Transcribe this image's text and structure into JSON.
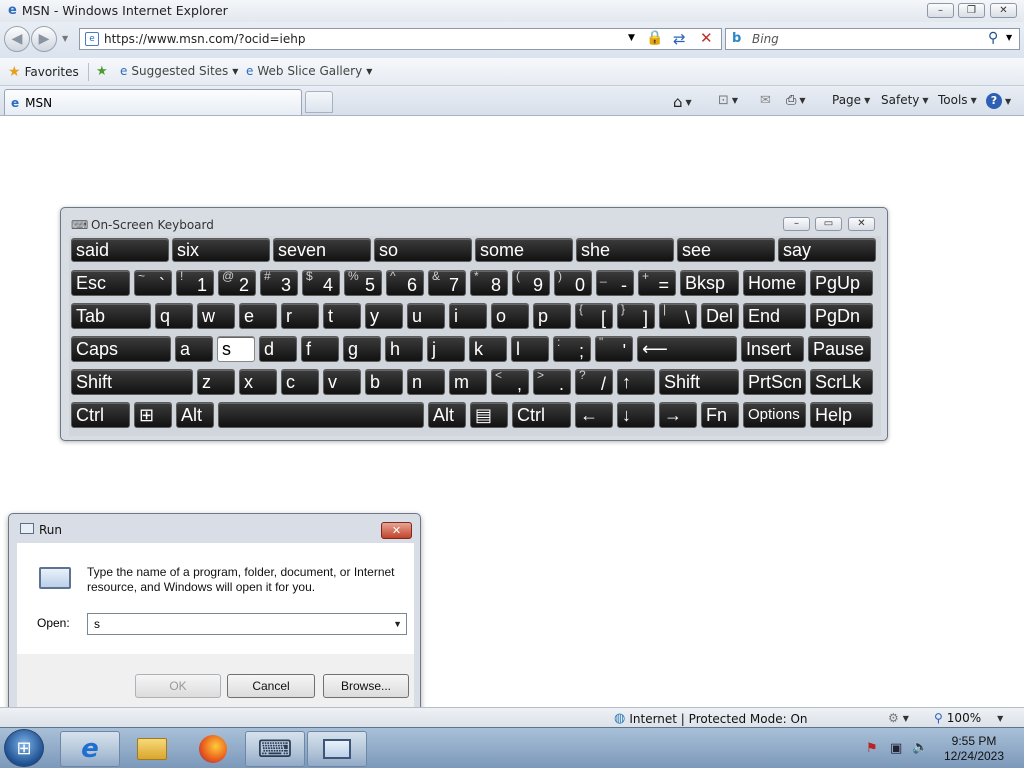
{
  "ie": {
    "window_title": "MSN - Windows Internet Explorer",
    "address": "https://www.msn.com/?ocid=iehp",
    "search_placeholder": "Bing",
    "favorites_label": "Favorites",
    "suggested_sites": "Suggested Sites",
    "web_slice_gallery": "Web Slice Gallery",
    "tab_title": "MSN",
    "cmd_page": "Page",
    "cmd_safety": "Safety",
    "cmd_tools": "Tools"
  },
  "statusbar": {
    "zone_text": "Internet | Protected Mode: On",
    "zoom": "100%"
  },
  "osk": {
    "title": "On-Screen Keyboard",
    "predictions": [
      "said",
      "six",
      "seven",
      "so",
      "some",
      "she",
      "see",
      "say"
    ],
    "rows": [
      [
        {
          "label": "Esc"
        },
        {
          "top": "~",
          "bot": "`"
        },
        {
          "top": "!",
          "bot": "1"
        },
        {
          "top": "@",
          "bot": "2"
        },
        {
          "top": "#",
          "bot": "3"
        },
        {
          "top": "$",
          "bot": "4"
        },
        {
          "top": "%",
          "bot": "5"
        },
        {
          "top": "^",
          "bot": "6"
        },
        {
          "top": "&",
          "bot": "7"
        },
        {
          "top": "*",
          "bot": "8"
        },
        {
          "top": "(",
          "bot": "9"
        },
        {
          "top": ")",
          "bot": "0"
        },
        {
          "top": "_",
          "bot": "-"
        },
        {
          "top": "+",
          "bot": "="
        },
        {
          "label": "Bksp"
        },
        {
          "label": "Home"
        },
        {
          "label": "PgUp"
        }
      ],
      [
        {
          "label": "Tab"
        },
        {
          "label": "q"
        },
        {
          "label": "w"
        },
        {
          "label": "e"
        },
        {
          "label": "r"
        },
        {
          "label": "t"
        },
        {
          "label": "y"
        },
        {
          "label": "u"
        },
        {
          "label": "i"
        },
        {
          "label": "o"
        },
        {
          "label": "p"
        },
        {
          "top": "{",
          "bot": "["
        },
        {
          "top": "}",
          "bot": "]"
        },
        {
          "top": "|",
          "bot": "\\"
        },
        {
          "label": "Del"
        },
        {
          "label": "End"
        },
        {
          "label": "PgDn"
        }
      ],
      [
        {
          "label": "Caps"
        },
        {
          "label": "a"
        },
        {
          "label": "s",
          "active": true
        },
        {
          "label": "d"
        },
        {
          "label": "f"
        },
        {
          "label": "g"
        },
        {
          "label": "h"
        },
        {
          "label": "j"
        },
        {
          "label": "k"
        },
        {
          "label": "l"
        },
        {
          "top": ":",
          "bot": ";"
        },
        {
          "top": "\"",
          "bot": "'"
        },
        {
          "label": "⟵"
        },
        {
          "label": "Insert"
        },
        {
          "label": "Pause"
        }
      ],
      [
        {
          "label": "Shift"
        },
        {
          "label": "z"
        },
        {
          "label": "x"
        },
        {
          "label": "c"
        },
        {
          "label": "v"
        },
        {
          "label": "b"
        },
        {
          "label": "n"
        },
        {
          "label": "m"
        },
        {
          "top": "<",
          "bot": ","
        },
        {
          "top": ">",
          "bot": "."
        },
        {
          "top": "?",
          "bot": "/"
        },
        {
          "label": "↑"
        },
        {
          "label": "Shift"
        },
        {
          "label": "PrtScn"
        },
        {
          "label": "ScrLk"
        }
      ],
      [
        {
          "label": "Ctrl"
        },
        {
          "label": "⊞"
        },
        {
          "label": "Alt"
        },
        {
          "label": ""
        },
        {
          "label": "Alt"
        },
        {
          "label": "▤"
        },
        {
          "label": "Ctrl"
        },
        {
          "label": "←"
        },
        {
          "label": "↓"
        },
        {
          "label": "→"
        },
        {
          "label": "Fn"
        },
        {
          "label": "Options"
        },
        {
          "label": "Help"
        }
      ]
    ]
  },
  "run": {
    "title": "Run",
    "description": "Type the name of a program, folder, document, or Internet resource, and Windows will open it for you.",
    "open_label": "Open:",
    "open_value": "s",
    "ok": "OK",
    "cancel": "Cancel",
    "browse": "Browse..."
  },
  "taskbar": {
    "time": "9:55 PM",
    "date": "12/24/2023"
  }
}
